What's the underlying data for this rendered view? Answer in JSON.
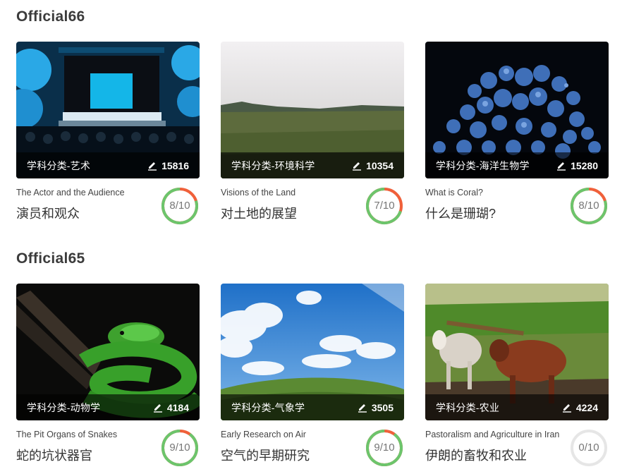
{
  "colors": {
    "score_green": "#6cc56c",
    "score_red": "#f0603a",
    "score_empty": "#e6e6e6"
  },
  "sections": [
    {
      "title": "Official66",
      "cards": [
        {
          "category": "学科分类-艺术",
          "count": "15816",
          "en": "The Actor and the Audience",
          "zh": "演员和观众",
          "score": "8/10",
          "score_value": 8,
          "image": "theater-stage"
        },
        {
          "category": "学科分类-环境科学",
          "count": "10354",
          "en": "Visions of the Land",
          "zh": "对土地的展望",
          "score": "7/10",
          "score_value": 7,
          "image": "moorland-landscape"
        },
        {
          "category": "学科分类-海洋生物学",
          "count": "15280",
          "en": "What is Coral?",
          "zh": "什么是珊瑚?",
          "score": "8/10",
          "score_value": 8,
          "image": "blue-coral"
        }
      ]
    },
    {
      "title": "Official65",
      "cards": [
        {
          "category": "学科分类-动物学",
          "count": "4184",
          "en": "The Pit Organs of Snakes",
          "zh": "蛇的坑状器官",
          "score": "9/10",
          "score_value": 9,
          "image": "green-python"
        },
        {
          "category": "学科分类-气象学",
          "count": "3505",
          "en": "Early Research on Air",
          "zh": "空气的早期研究",
          "score": "9/10",
          "score_value": 9,
          "image": "sky-and-hill"
        },
        {
          "category": "学科分类-农业",
          "count": "4224",
          "en": "Pastoralism and Agriculture in Iran",
          "zh": "伊朗的畜牧和农业",
          "score": "0/10",
          "score_value": 0,
          "image": "oxen-plowing"
        }
      ]
    }
  ]
}
